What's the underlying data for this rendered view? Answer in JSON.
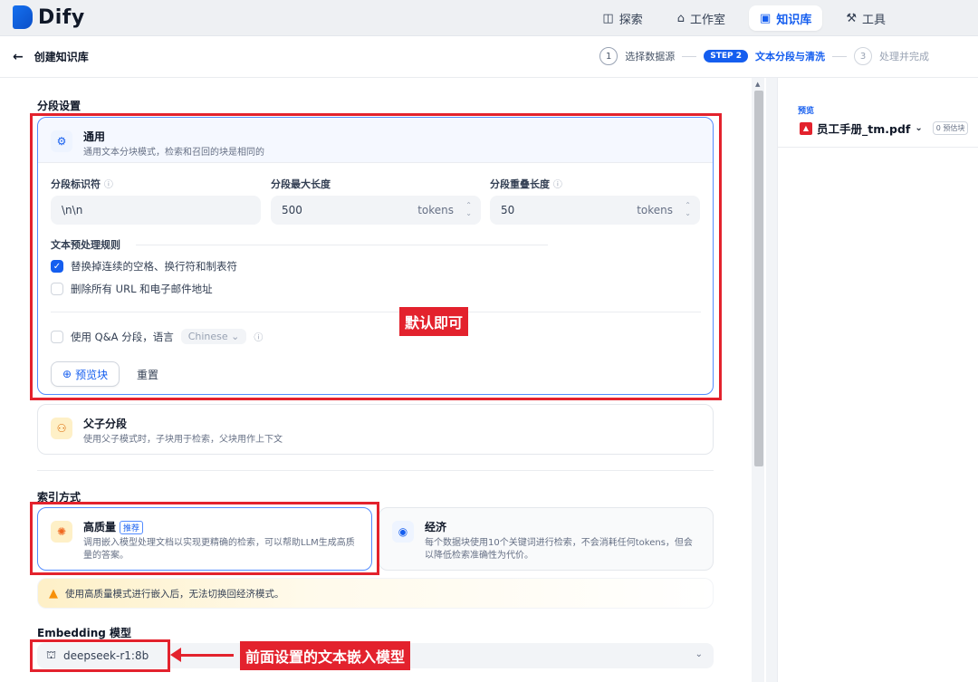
{
  "app": {
    "logo_text": "Dify"
  },
  "nav": {
    "items": [
      {
        "label": "探索",
        "icon": "explore-icon",
        "glyph": "◫"
      },
      {
        "label": "工作室",
        "icon": "robot-icon",
        "glyph": "⌂"
      },
      {
        "label": "知识库",
        "icon": "book-icon",
        "glyph": "▣"
      },
      {
        "label": "工具",
        "icon": "tool-icon",
        "glyph": "⚒"
      }
    ],
    "active": "知识库"
  },
  "subheader": {
    "back_label": "创建知识库",
    "steps": [
      {
        "num": "1",
        "label": "选择数据源"
      },
      {
        "num": "STEP 2",
        "label": "文本分段与清洗"
      },
      {
        "num": "3",
        "label": "处理并完成"
      }
    ]
  },
  "segment": {
    "section_title": "分段设置",
    "general": {
      "title": "通用",
      "desc": "通用文本分块模式，检索和召回的块是相同的"
    },
    "fields": {
      "separator_label": "分段标识符",
      "separator_value": "\\n\\n",
      "max_len_label": "分段最大长度",
      "max_len_value": "500",
      "overlap_label": "分段重叠长度",
      "overlap_value": "50",
      "unit": "tokens"
    },
    "rules_title": "文本预处理规则",
    "rule1": "替换掉连续的空格、换行符和制表符",
    "rule2": "删除所有 URL 和电子邮件地址",
    "qa_label": "使用 Q&A 分段，语言",
    "qa_language": "Chinese",
    "preview_btn": "预览块",
    "reset_btn": "重置",
    "annotation": "默认即可",
    "parent_child": {
      "title": "父子分段",
      "desc": "使用父子模式时，子块用于检索，父块用作上下文"
    }
  },
  "index": {
    "section_title": "索引方式",
    "high_quality": {
      "title": "高质量",
      "badge": "推荐",
      "desc": "调用嵌入模型处理文档以实现更精确的检索，可以帮助LLM生成高质量的答案。"
    },
    "economy": {
      "title": "经济",
      "desc": "每个数据块使用10个关键词进行检索，不会消耗任何tokens，但会以降低检索准确性为代价。"
    },
    "warning": "使用高质量模式进行嵌入后，无法切换回经济模式。"
  },
  "embedding": {
    "section_title": "Embedding 模型",
    "model": "deepseek-r1:8b",
    "annotation": "前面设置的文本嵌入模型"
  },
  "preview": {
    "label": "预览",
    "file": "员工手册_tm.pdf",
    "count": "0 预估块"
  },
  "colors": {
    "accent": "#155eef",
    "annotation_red": "#e3222d"
  }
}
